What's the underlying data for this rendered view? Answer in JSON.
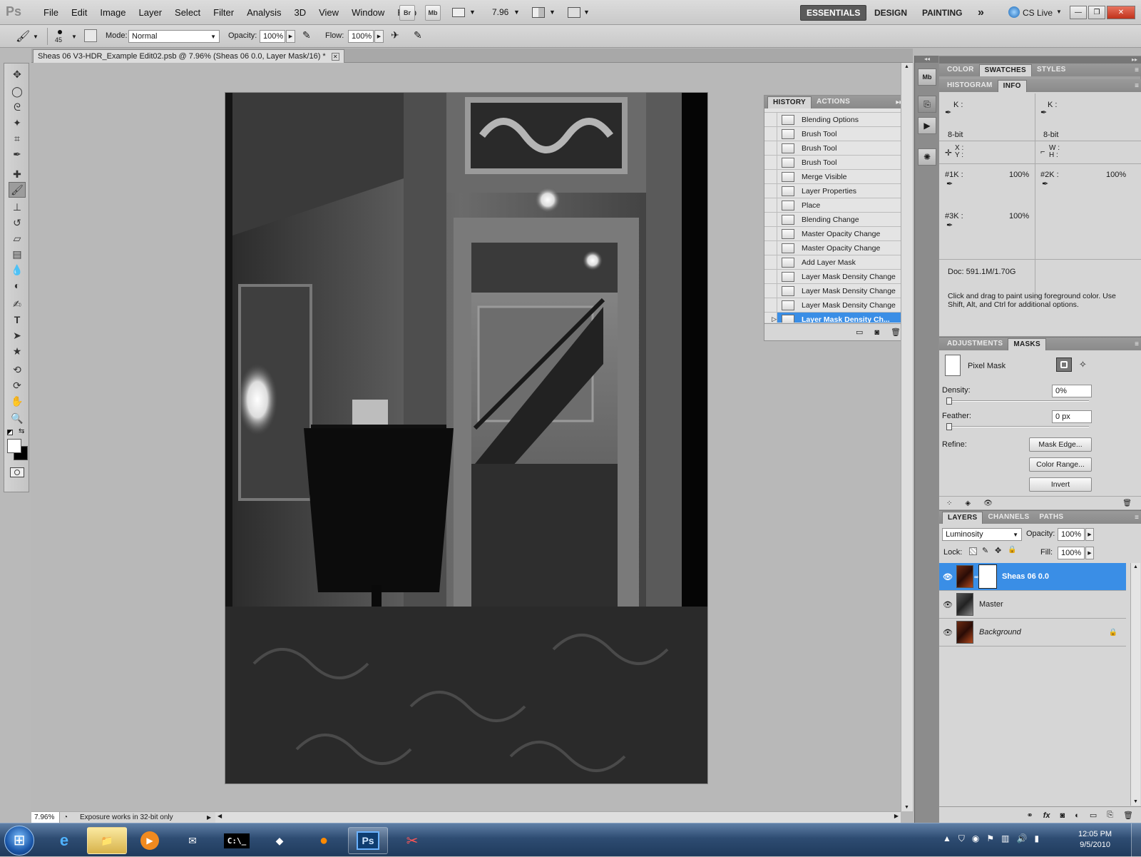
{
  "app": {
    "logo": "Ps"
  },
  "menubar": {
    "items": [
      "File",
      "Edit",
      "Image",
      "Layer",
      "Select",
      "Filter",
      "Analysis",
      "3D",
      "View",
      "Window",
      "Help"
    ],
    "bridge_label": "Br",
    "mini_bridge_label": "Mb",
    "zoom_value": "7.96",
    "workspaces": {
      "essentials": "ESSENTIALS",
      "design": "DESIGN",
      "painting": "PAINTING",
      "more": "»"
    },
    "cs_live": "CS Live"
  },
  "options": {
    "brush_size": "45",
    "mode_label": "Mode:",
    "mode_value": "Normal",
    "opacity_label": "Opacity:",
    "opacity_value": "100%",
    "flow_label": "Flow:",
    "flow_value": "100%"
  },
  "document": {
    "tab_title": "Sheas 06 V3-HDR_Example Edit02.psb @ 7.96% (Sheas 06  0.0, Layer Mask/16) *"
  },
  "status": {
    "zoom": "7.96%",
    "message": "Exposure works in 32-bit only"
  },
  "history_panel": {
    "tabs": [
      "HISTORY",
      "ACTIONS"
    ],
    "items": [
      "Blending Options",
      "Brush Tool",
      "Brush Tool",
      "Brush Tool",
      "Merge Visible",
      "Layer Properties",
      "Place",
      "Blending Change",
      "Master Opacity Change",
      "Master Opacity Change",
      "Add Layer Mask",
      "Layer Mask Density Change",
      "Layer Mask Density Change",
      "Layer Mask Density Change",
      "Layer Mask Density Ch..."
    ],
    "selected_index": 14
  },
  "color_panel": {
    "tabs": [
      "COLOR",
      "SWATCHES",
      "STYLES"
    ],
    "active": "SWATCHES"
  },
  "info_panel": {
    "tabs": [
      "HISTOGRAM",
      "INFO"
    ],
    "k_label": "K :",
    "bit_depth": "8-bit",
    "x_label": "X :",
    "y_label": "Y :",
    "w_label": "W :",
    "h_label": "H :",
    "k1_label": "#1K :",
    "k1_value": "100%",
    "k2_label": "#2K :",
    "k2_value": "100%",
    "k3_label": "#3K :",
    "k3_value": "100%",
    "doc": "Doc: 591.1M/1.70G",
    "hint": "Click and drag to paint using foreground color.  Use Shift, Alt, and Ctrl for additional options."
  },
  "masks_panel": {
    "tabs": [
      "ADJUSTMENTS",
      "MASKS"
    ],
    "mask_type": "Pixel Mask",
    "density_label": "Density:",
    "density_value": "0%",
    "density_level": 0,
    "feather_label": "Feather:",
    "feather_value": "0 px",
    "feather_level": 0,
    "refine_label": "Refine:",
    "mask_edge": "Mask Edge...",
    "color_range": "Color Range...",
    "invert": "Invert"
  },
  "layers_panel": {
    "tabs": [
      "LAYERS",
      "CHANNELS",
      "PATHS"
    ],
    "blend_mode": "Luminosity",
    "opacity_label": "Opacity:",
    "opacity_value": "100%",
    "lock_label": "Lock:",
    "fill_label": "Fill:",
    "fill_value": "100%",
    "layers": [
      {
        "name": "Sheas 06  0.0",
        "selected": true
      },
      {
        "name": "Master",
        "selected": false
      },
      {
        "name": "Background",
        "selected": false
      }
    ]
  },
  "taskbar": {
    "time": "12:05 PM",
    "date": "9/5/2010",
    "ps_label": "Ps",
    "cmd_label": "C:\\_"
  }
}
